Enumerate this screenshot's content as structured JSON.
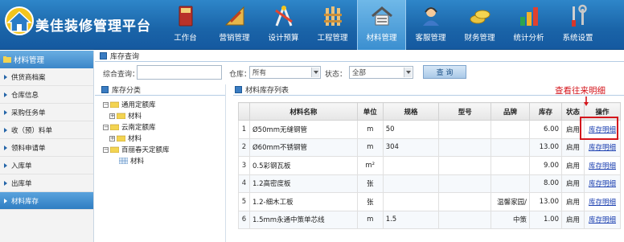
{
  "header": {
    "brand": "美佳装修管理平台",
    "nav": [
      {
        "label": "工作台",
        "icon": "book-icon"
      },
      {
        "label": "营销管理",
        "icon": "ruler-pencil-icon"
      },
      {
        "label": "设计预算",
        "icon": "design-tools-icon"
      },
      {
        "label": "工程管理",
        "icon": "fence-icon"
      },
      {
        "label": "材料管理",
        "icon": "house-icon",
        "active": true
      },
      {
        "label": "客服管理",
        "icon": "support-person-icon"
      },
      {
        "label": "财务管理",
        "icon": "coins-icon"
      },
      {
        "label": "统计分析",
        "icon": "bar-chart-icon"
      },
      {
        "label": "系统设置",
        "icon": "wrench-screwdriver-icon"
      }
    ]
  },
  "sidebar": {
    "title": "材料管理",
    "items": [
      {
        "label": "供货商档案"
      },
      {
        "label": "仓库信息"
      },
      {
        "label": "采购任务单"
      },
      {
        "label": "收（预）料单"
      },
      {
        "label": "领料申请单"
      },
      {
        "label": "入库单"
      },
      {
        "label": "出库单"
      },
      {
        "label": "材料库存",
        "active": true
      }
    ]
  },
  "query": {
    "title": "库存查询",
    "keyword_label": "综合查询：",
    "keyword_value": "",
    "warehouse_label": "仓库：",
    "warehouse_value": "所有",
    "status_label": "状态：",
    "status_value": "全部",
    "search_label": "查 询"
  },
  "category": {
    "title": "库存分类",
    "tree": [
      {
        "label": "通用定额库",
        "level": 0,
        "toggle": "⊟"
      },
      {
        "label": "材料",
        "level": 1,
        "toggle": "⊞"
      },
      {
        "label": "云南定额库",
        "level": 0,
        "toggle": "⊟"
      },
      {
        "label": "材料",
        "level": 1,
        "toggle": "⊞"
      },
      {
        "label": "百丽春天定额库",
        "level": 0,
        "toggle": "⊟"
      },
      {
        "label": "材料",
        "level": 2,
        "toggle": ""
      }
    ]
  },
  "stock_list": {
    "title": "材料库存列表",
    "columns": [
      "",
      "材料名称",
      "单位",
      "规格",
      "型号",
      "品牌",
      "库存",
      "状态",
      "操作"
    ],
    "rows": [
      {
        "no": "1",
        "name": "Ø50mm无缝钢管",
        "unit": "m",
        "spec": "50",
        "model": "",
        "brand": "",
        "stock": "6.00",
        "status": "启用",
        "action": "库存明细"
      },
      {
        "no": "2",
        "name": "Ø60mm不锈钢管",
        "unit": "m",
        "spec": "304",
        "model": "",
        "brand": "",
        "stock": "13.00",
        "status": "启用",
        "action": "库存明细"
      },
      {
        "no": "3",
        "name": "0.5彩钢瓦板",
        "unit": "m²",
        "spec": "",
        "model": "",
        "brand": "",
        "stock": "9.00",
        "status": "启用",
        "action": "库存明细"
      },
      {
        "no": "4",
        "name": "1.2高密度板",
        "unit": "张",
        "spec": "",
        "model": "",
        "brand": "",
        "stock": "8.00",
        "status": "启用",
        "action": "库存明细"
      },
      {
        "no": "5",
        "name": "1.2-细木工板",
        "unit": "张",
        "spec": "",
        "model": "",
        "brand": "温馨家园/",
        "stock": "13.00",
        "status": "启用",
        "action": "库存明细"
      },
      {
        "no": "6",
        "name": "1.5mm永通中策单芯线",
        "unit": "m",
        "spec": "1.5",
        "model": "",
        "brand": "中策",
        "stock": "1.00",
        "status": "启用",
        "action": "库存明细"
      }
    ]
  },
  "annotation": {
    "text": "查看往来明细",
    "color": "#d4161c"
  }
}
